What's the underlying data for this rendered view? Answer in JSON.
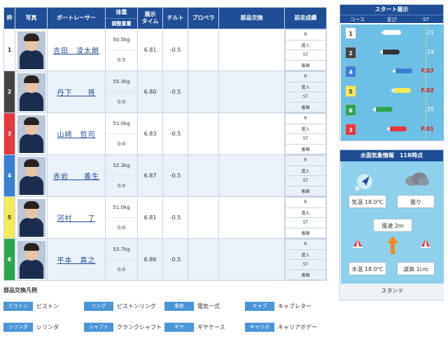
{
  "headers": {
    "waku": "枠",
    "photo": "写真",
    "racer": "ボートレーサー",
    "weight": "体重",
    "adjust": "調整重量",
    "exhibit_line1": "展示",
    "exhibit_line2": "タイム",
    "tilt": "チルト",
    "propeller": "プロペラ",
    "parts": "部品交換",
    "prev": "前走成績"
  },
  "prev_labels": [
    "R",
    "進入",
    "ST",
    "着順"
  ],
  "racers": [
    {
      "waku": "1",
      "name": "吉田　凌太朗",
      "weight": "50.5kg",
      "adjust": "0.5",
      "time": "6.81",
      "tilt": "-0.5",
      "color": "#ffffff",
      "text": "#333333"
    },
    {
      "waku": "2",
      "name": "丹下　　将",
      "weight": "55.3kg",
      "adjust": "0.0",
      "time": "6.80",
      "tilt": "-0.5",
      "color": "#444444",
      "text": "#ffffff"
    },
    {
      "waku": "3",
      "name": "山崎　哲司",
      "weight": "51.0kg",
      "adjust": "0.0",
      "time": "6.83",
      "tilt": "-0.5",
      "color": "#e8363f",
      "text": "#ffffff"
    },
    {
      "waku": "4",
      "name": "赤岩　　善生",
      "weight": "52.3kg",
      "adjust": "0.0",
      "time": "6.87",
      "tilt": "-0.5",
      "color": "#3b7fd4",
      "text": "#ffffff"
    },
    {
      "waku": "5",
      "name": "河村　　了",
      "weight": "51.0kg",
      "adjust": "0.0",
      "time": "6.81",
      "tilt": "-0.5",
      "color": "#f5ea5a",
      "text": "#333333"
    },
    {
      "waku": "6",
      "name": "平本　真之",
      "weight": "53.7kg",
      "adjust": "0.0",
      "time": "6.86",
      "tilt": "-0.5",
      "color": "#2ea44f",
      "text": "#ffffff"
    }
  ],
  "start": {
    "title": "スタート展示",
    "cols": [
      "コース",
      "並び",
      "ST"
    ],
    "rows": [
      {
        "course": "1",
        "st": ".21",
        "flying": false,
        "color": "#ffffff",
        "text": "#333333",
        "boat": "#ffffff"
      },
      {
        "course": "2",
        "st": ".24",
        "flying": false,
        "color": "#444444",
        "text": "#ffffff",
        "boat": "#333333"
      },
      {
        "course": "4",
        "st": "F.07",
        "flying": true,
        "color": "#3b7fd4",
        "text": "#ffffff",
        "boat": "#3b7fd4"
      },
      {
        "course": "5",
        "st": "F.02",
        "flying": true,
        "color": "#f5ea5a",
        "text": "#333333",
        "boat": "#f5ea5a"
      },
      {
        "course": "6",
        "st": ".35",
        "flying": false,
        "color": "#2ea44f",
        "text": "#ffffff",
        "boat": "#2ea44f"
      },
      {
        "course": "3",
        "st": "F.01",
        "flying": true,
        "color": "#e8363f",
        "text": "#ffffff",
        "boat": "#e8363f"
      }
    ]
  },
  "weather": {
    "title": "水面気象情報　11R時点",
    "temp": "気温 18.0℃",
    "sky": "曇り",
    "wind": "風速 2m",
    "water_temp": "水温 18.0℃",
    "wave": "波高 1cm",
    "footer": "スタンド",
    "compass": "N"
  },
  "legend": {
    "title": "部品交換凡例",
    "items": [
      {
        "tag": "ピストン",
        "desc": "ピストン"
      },
      {
        "tag": "リング",
        "desc": "ピストンリング"
      },
      {
        "tag": "電気",
        "desc": "電気一式"
      },
      {
        "tag": "キャブ",
        "desc": "キャブレター"
      },
      {
        "tag": "シリンダ",
        "desc": "シリンダ"
      },
      {
        "tag": "シャフト",
        "desc": "クランクシャフト"
      },
      {
        "tag": "ギヤ",
        "desc": "ギヤケース"
      },
      {
        "tag": "キャリボ",
        "desc": "キャリアボデー"
      }
    ]
  }
}
